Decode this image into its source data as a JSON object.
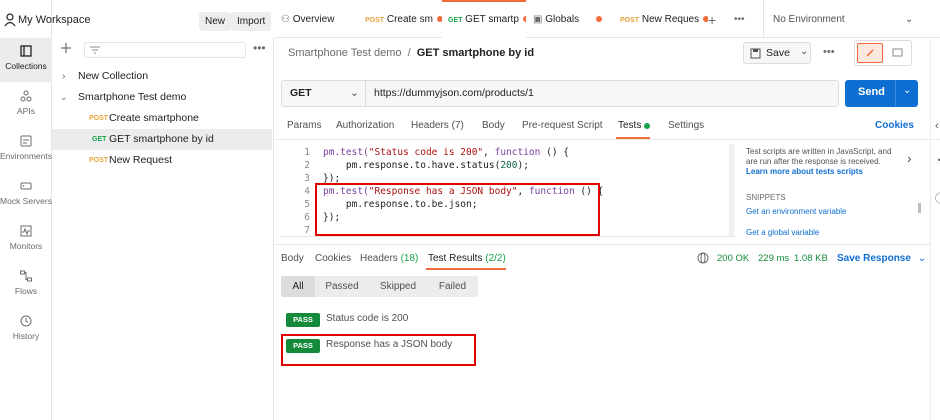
{
  "workspace": {
    "name": "My Workspace",
    "new_label": "New",
    "import_label": "Import"
  },
  "rail": [
    {
      "label": "Collections",
      "icon": "collections-icon"
    },
    {
      "label": "APIs",
      "icon": "apis-icon"
    },
    {
      "label": "Environments",
      "icon": "environments-icon"
    },
    {
      "label": "Mock Servers",
      "icon": "mock-servers-icon"
    },
    {
      "label": "Monitors",
      "icon": "monitors-icon"
    },
    {
      "label": "Flows",
      "icon": "flows-icon"
    },
    {
      "label": "History",
      "icon": "history-icon"
    }
  ],
  "sidebar": {
    "tree": [
      {
        "label": "New Collection"
      },
      {
        "label": "Smartphone Test demo"
      },
      {
        "method": "POST",
        "label": "Create smartphone"
      },
      {
        "method": "GET",
        "label": "GET smartphone by id"
      },
      {
        "method": "POST",
        "label": "New Request"
      }
    ]
  },
  "tabs": [
    {
      "label": "Overview"
    },
    {
      "method": "POST",
      "label": "Create sm"
    },
    {
      "method": "GET",
      "label": "GET smartp"
    },
    {
      "label": "Globals"
    },
    {
      "method": "POST",
      "label": "New Reques"
    }
  ],
  "environment": "No Environment",
  "breadcrumb": {
    "collection": "Smartphone Test demo",
    "separator": "/",
    "request": "GET smartphone by id"
  },
  "save_label": "Save",
  "request": {
    "method": "GET",
    "url": "https://dummyjson.com/products/1",
    "send_label": "Send"
  },
  "request_tabs": {
    "params": "Params",
    "authorization": "Authorization",
    "headers": "Headers (7)",
    "body": "Body",
    "prerequest": "Pre-request Script",
    "tests": "Tests",
    "settings": "Settings",
    "cookies": "Cookies"
  },
  "editor": {
    "line_numbers": [
      "1",
      "2",
      "3",
      "4",
      "5",
      "6",
      "7"
    ],
    "lines": [
      {
        "kw": "pm.test(",
        "str": "\"Status code is 200\"",
        "mid": ", ",
        "kw2": "function",
        "rest": " () {"
      },
      {
        "pre": "    pm.response.to.have.status(",
        "num": "200",
        "rest": ");"
      },
      {
        "text": "});"
      },
      {
        "kw": "pm.test(",
        "str": "\"Response has a JSON body\"",
        "mid": ", ",
        "kw2": "function",
        "rest": " () {"
      },
      {
        "text": "    pm.response.to.be.json;"
      },
      {
        "text": "});"
      },
      {
        "text": ""
      }
    ]
  },
  "help": {
    "line1": "Test scripts are written in JavaScript, and",
    "line2": "are run after the response is received.",
    "learn_more": "Learn more about tests scripts",
    "snippets_label": "SNIPPETS",
    "snippet1": "Get an environment variable",
    "snippet2": "Get a global variable"
  },
  "response": {
    "tabs": {
      "body": "Body",
      "cookies": "Cookies",
      "headers": "Headers",
      "headers_count": "(18)",
      "test_results": "Test Results",
      "test_count": "(2/2)"
    },
    "status": "200 OK",
    "time": "229 ms",
    "size": "1.08 KB",
    "save_response": "Save Response",
    "filters": [
      "All",
      "Passed",
      "Skipped",
      "Failed"
    ],
    "results": [
      {
        "badge": "PASS",
        "name": "Status code is 200"
      },
      {
        "badge": "PASS",
        "name": "Response has a JSON body"
      }
    ]
  },
  "colors": {
    "accent": "#f26b3a",
    "send": "#0f6ed1",
    "pass": "#148a3a",
    "highlight": "#e00000"
  }
}
